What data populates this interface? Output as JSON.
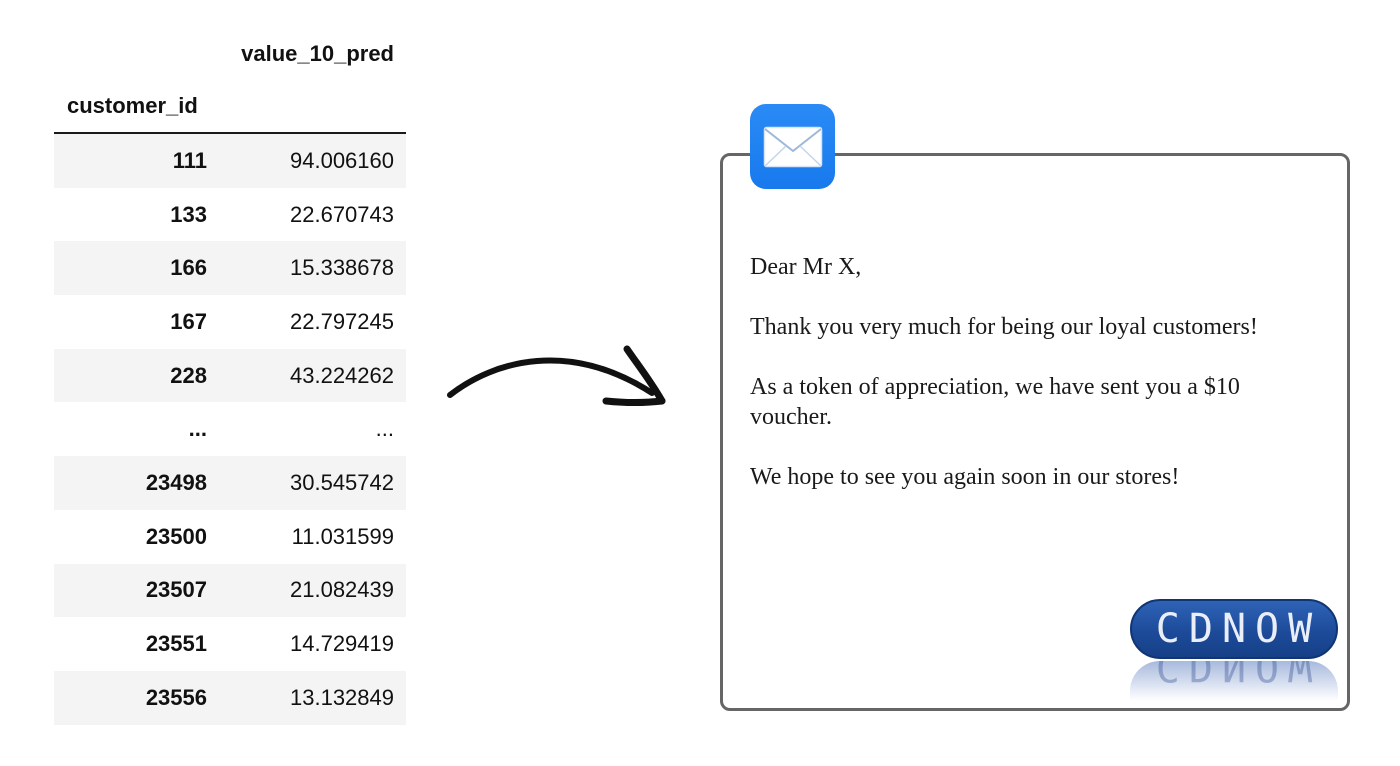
{
  "table": {
    "column_header": "value_10_pred",
    "index_header": "customer_id",
    "rows": [
      {
        "id": "111",
        "value": "94.006160"
      },
      {
        "id": "133",
        "value": "22.670743"
      },
      {
        "id": "166",
        "value": "15.338678"
      },
      {
        "id": "167",
        "value": "22.797245"
      },
      {
        "id": "228",
        "value": "43.224262"
      },
      {
        "id": "...",
        "value": "..."
      },
      {
        "id": "23498",
        "value": "30.545742"
      },
      {
        "id": "23500",
        "value": "11.031599"
      },
      {
        "id": "23507",
        "value": "21.082439"
      },
      {
        "id": "23551",
        "value": "14.729419"
      },
      {
        "id": "23556",
        "value": "13.132849"
      }
    ]
  },
  "letter": {
    "greeting": "Dear Mr X,",
    "thanks": "Thank you very much for being our loyal customers!",
    "voucher": "As a token of appreciation, we have sent you a $10 voucher.",
    "closing": "We hope to see you again soon in our stores!",
    "icon": "mail-envelope-icon",
    "icon_color": "#1E82F2"
  },
  "logo": {
    "text": "CDNOW",
    "color": "#1D4B9A"
  }
}
